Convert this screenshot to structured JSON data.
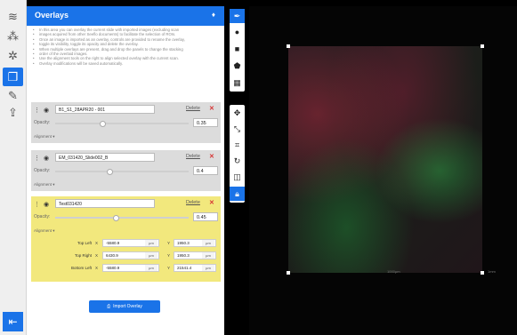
{
  "panel": {
    "title": "Overlays",
    "close_glyph": "♦",
    "notes": [
      "In this area you can overlay the current slide with imported images (excluding scan",
      "images acquired from other Seeflo documents) to facilitate the selection of ROIs.",
      "Once an image is imported as an overlay, controls are provided to rename the overlay,",
      "toggle its visibility, toggle its opacity and delete the overlay.",
      "When multiple overlays are present, drag and drop the panels to change the stacking",
      "order of the overlaid images.",
      "Use the alignment tools on the right to align selected overlay with the current scan.",
      "Overlay modifications will be saved automatically."
    ]
  },
  "overlays": [
    {
      "name": "B1_S1_28APR20 - 001",
      "delete_label": "Delete",
      "opacity_label": "Opacity:",
      "opacity": "0.35",
      "alignment_label": "Alignment ▾"
    },
    {
      "name": "EM_031420_Slide002_B",
      "delete_label": "Delete",
      "opacity_label": "Opacity:",
      "opacity": "0.4",
      "alignment_label": "Alignment ▾"
    },
    {
      "name": "Test031420",
      "delete_label": "Delete",
      "opacity_label": "Opacity:",
      "opacity": "0.45",
      "alignment_label": "Alignment ▾",
      "coords": [
        {
          "label": "Top Left",
          "x_axis": "X",
          "x": "-5580.9",
          "x_unit": "µm",
          "y_axis": "Y",
          "y": "1950.3",
          "y_unit": "µm"
        },
        {
          "label": "Top Right",
          "x_axis": "X",
          "x": "6430.9",
          "x_unit": "µm",
          "y_axis": "Y",
          "y": "1950.3",
          "y_unit": "µm"
        },
        {
          "label": "Bottom Left",
          "x_axis": "X",
          "x": "-5580.9",
          "x_unit": "µm",
          "y_axis": "Y",
          "y": "21541.4",
          "y_unit": "µm"
        }
      ]
    }
  ],
  "import_button": {
    "label": "Import Overlay"
  },
  "viewer": {
    "scale_left": "1000µm",
    "scale_right": "1mm"
  },
  "colors": {
    "accent": "#1a73e8",
    "selected_overlay": "#f2e87d",
    "overlay_card": "#dcdcdc",
    "delete": "#d63333"
  },
  "icons": {
    "rail": [
      "slide-icon",
      "channels-icon",
      "settings-icon",
      "overlays-icon",
      "annotate-icon",
      "export-icon"
    ],
    "tools_top": [
      "pen-icon",
      "point-icon",
      "square-icon",
      "polygon-icon",
      "grid-icon"
    ],
    "tools_align": [
      "move-icon",
      "scale-icon",
      "crop-icon",
      "rotate-icon",
      "flip-icon",
      "lock-icon"
    ]
  }
}
